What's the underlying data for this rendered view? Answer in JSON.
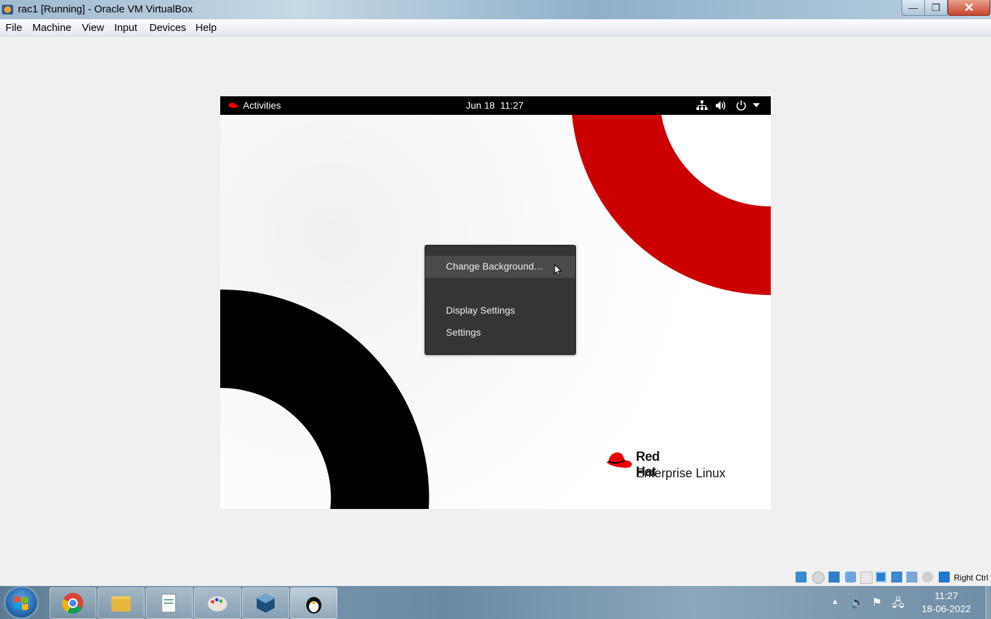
{
  "window": {
    "title": "rac1 [Running] - Oracle VM VirtualBox",
    "controls": {
      "minimize": "—",
      "maximize": "❐",
      "close": "✕"
    }
  },
  "menubar": {
    "items": [
      "File",
      "Machine",
      "View",
      "Input",
      "Devices",
      "Help"
    ]
  },
  "guest": {
    "topbar": {
      "activities": "Activities",
      "date": "Jun 18",
      "time": "11:27",
      "tray_icons": [
        "network-icon",
        "volume-icon",
        "power-icon",
        "dropdown-arrow-icon"
      ]
    },
    "context_menu": {
      "items": [
        "Change Background…",
        "Display Settings",
        "Settings"
      ],
      "highlighted": "Change Background…"
    },
    "logo": {
      "line1": "Red Hat",
      "line2": "Enterprise Linux"
    },
    "colors": {
      "accent_red": "#ee0000",
      "wallpaper_red": "#cc0000",
      "wallpaper_black": "#000000"
    }
  },
  "statusbar": {
    "icons": [
      "hard-disk-icon",
      "optical-drive-icon",
      "network-icon",
      "usb-icon",
      "shared-folder-icon",
      "display-icon",
      "video-capture-icon",
      "cpu-virtualization-icon",
      "mouse-integration-icon",
      "keyboard-capture-icon"
    ],
    "host_key": "Right Ctrl"
  },
  "taskbar": {
    "apps": [
      "chrome-icon",
      "file-explorer-icon",
      "notepad-icon",
      "paint-icon",
      "virtualbox-icon",
      "linux-vm-icon"
    ],
    "clock_time": "11:27",
    "clock_date": "18-06-2022"
  }
}
